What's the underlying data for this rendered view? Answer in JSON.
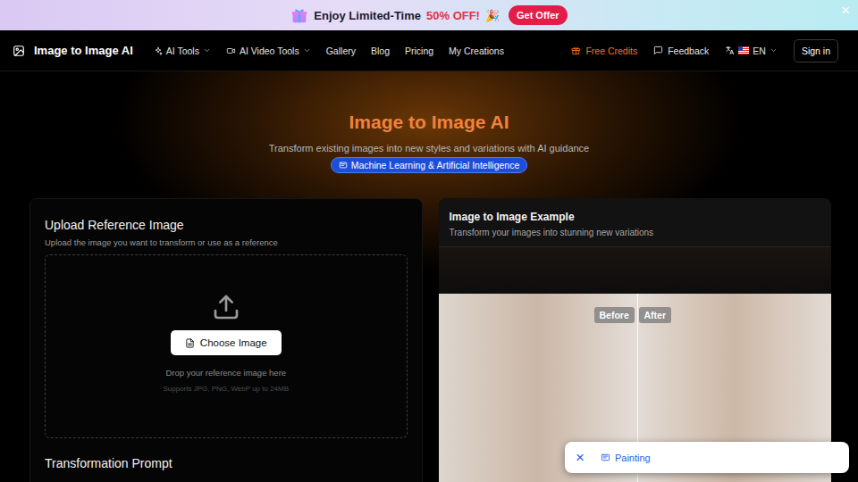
{
  "banner": {
    "text": "Enjoy Limited-Time",
    "highlight": "50% OFF!",
    "emoji": "🎉",
    "button": "Get Offer",
    "close": "×"
  },
  "nav": {
    "logo": "Image to Image AI",
    "menu": [
      {
        "label": "AI Tools",
        "kind": "dropdown"
      },
      {
        "label": "AI Video Tools",
        "kind": "dropdown"
      },
      {
        "label": "Gallery",
        "kind": "link"
      },
      {
        "label": "Blog",
        "kind": "link"
      },
      {
        "label": "Pricing",
        "kind": "link"
      },
      {
        "label": "My Creations",
        "kind": "link"
      }
    ],
    "free_credits": "Free Credits",
    "feedback": "Feedback",
    "language": "EN",
    "sign_in": "Sign in"
  },
  "hero": {
    "title": "Image to Image AI",
    "subtitle": "Transform existing images into new styles and variations with AI guidance",
    "badge": "Machine Learning & Artificial Intelligence"
  },
  "upload": {
    "title": "Upload Reference Image",
    "subtitle": "Upload the image you want to transform or use as a reference",
    "button": "Choose Image",
    "drop_text": "Drop your reference image here",
    "formats": "Supports JPG, PNG, WebP up to 24MB"
  },
  "prompt": {
    "title": "Transformation Prompt"
  },
  "example": {
    "title": "Image to Image Example",
    "subtitle": "Transform your images into stunning new variations",
    "before": "Before",
    "after": "After"
  },
  "toast": {
    "close": "×",
    "label": "Painting"
  }
}
